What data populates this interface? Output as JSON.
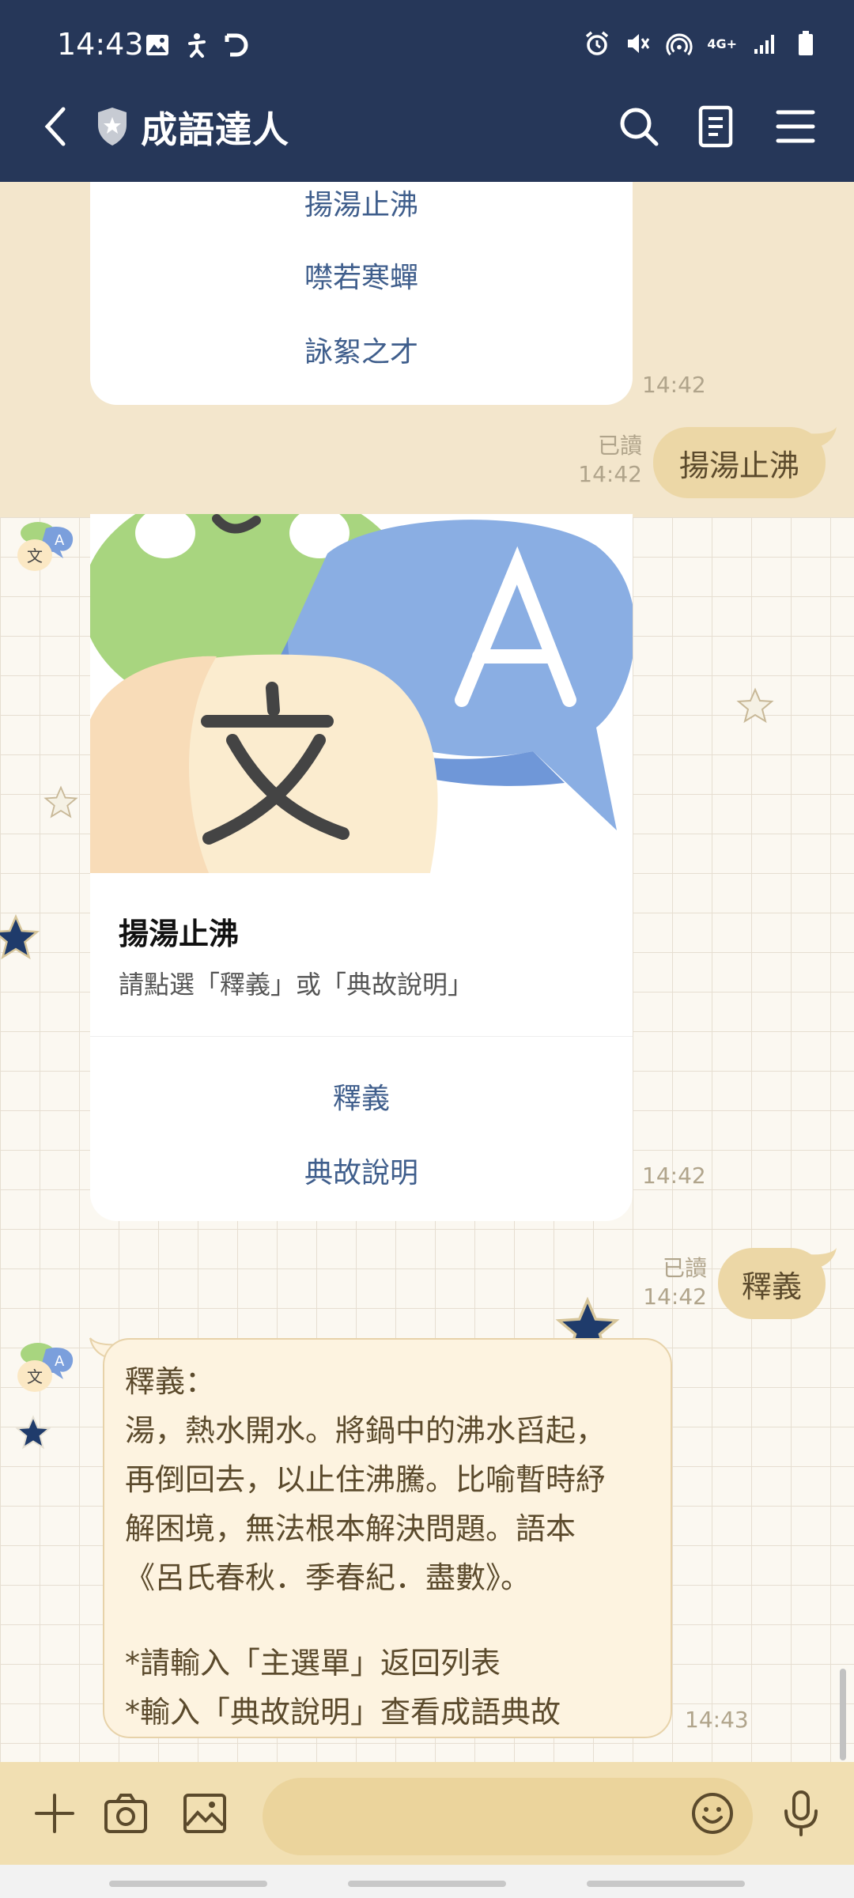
{
  "status_bar": {
    "time": "14:43",
    "network": "4G+"
  },
  "header": {
    "title": "成語達人"
  },
  "messages": {
    "menu_card": {
      "items": [
        "揚湯止沸",
        "噤若寒蟬",
        "詠絮之才"
      ],
      "time": "14:42"
    },
    "user_msg_1": {
      "read": "已讀",
      "time": "14:42",
      "text": "揚湯止沸"
    },
    "idiom_card": {
      "title": "揚湯止沸",
      "subtitle": "請點選「釋義」或「典故說明」",
      "options": [
        "釋義",
        "典故說明"
      ],
      "time": "14:42"
    },
    "user_msg_2": {
      "read": "已讀",
      "time": "14:42",
      "text": "釋義"
    },
    "bot_reply": {
      "lines": [
        "釋義：",
        "湯，熱水開水。將鍋中的沸水舀起，",
        "再倒回去，以止住沸騰。比喻暫時紓",
        "解困境，無法根本解決問題。語本",
        "《呂氏春秋．季春紀．盡數》。"
      ],
      "notes": [
        "*請輸入「主選單」返回列表",
        "*輸入「典故說明」查看成語典故"
      ],
      "time": "14:43"
    }
  },
  "input_bar": {
    "placeholder": ""
  },
  "colors": {
    "header_bg": "#263759",
    "chat_bg": "#f3e6cc",
    "user_bubble": "#ecd7a6",
    "link": "#3f5e8c",
    "input_bar": "#f1dfb2"
  }
}
